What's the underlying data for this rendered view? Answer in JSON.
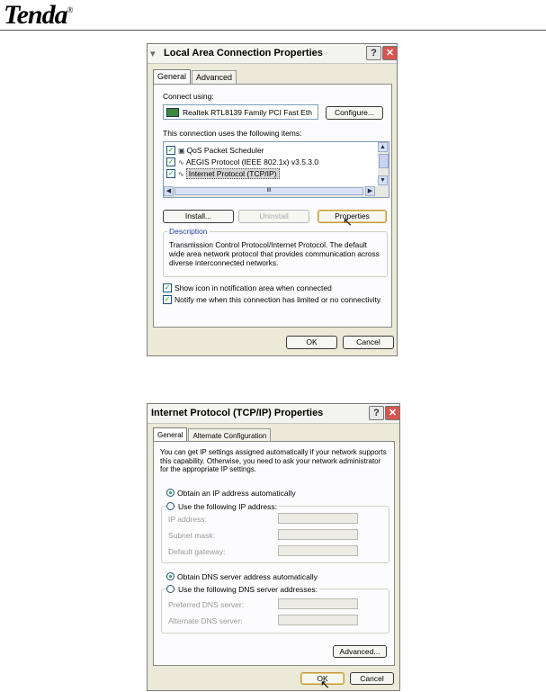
{
  "header": {
    "logo_text": "Tenda",
    "logo_mark": "®"
  },
  "dialog1": {
    "title": "Local Area Connection Properties",
    "tabs": [
      "General",
      "Advanced"
    ],
    "connect_using_label": "Connect using:",
    "adapter_name": "Realtek RTL8139 Family PCI Fast Eth",
    "configure_label": "Configure...",
    "items_label": "This connection uses the following items:",
    "items": [
      {
        "label": "QoS Packet Scheduler",
        "checked": true
      },
      {
        "label": "AEGIS Protocol (IEEE 802.1x) v3.5.3.0",
        "checked": true
      },
      {
        "label": "Internet Protocol (TCP/IP)",
        "checked": true,
        "selected": true
      }
    ],
    "scroll_mid": "III",
    "install_label": "Install...",
    "uninstall_label": "Uninstall",
    "properties_label": "Properties",
    "description_title": "Description",
    "description_text": "Transmission Control Protocol/Internet Protocol. The default wide area network protocol that provides communication across diverse interconnected networks.",
    "show_icon_label": "Show icon in notification area when connected",
    "notify_label": "Notify me when this connection has limited or no connectivity",
    "ok_label": "OK",
    "cancel_label": "Cancel"
  },
  "dialog2": {
    "title": "Internet Protocol (TCP/IP) Properties",
    "tabs": [
      "General",
      "Alternate Configuration"
    ],
    "intro_text": "You can get IP settings assigned automatically if your network supports this capability. Otherwise, you need to ask your network administrator for the appropriate IP settings.",
    "obtain_ip_label": "Obtain an IP address automatically",
    "use_ip_label": "Use the following IP address:",
    "ip_address_label": "IP address:",
    "subnet_label": "Subnet mask:",
    "gateway_label": "Default gateway:",
    "obtain_dns_label": "Obtain DNS server address automatically",
    "use_dns_label": "Use the following DNS server addresses:",
    "preferred_dns_label": "Preferred DNS server:",
    "alternate_dns_label": "Alternate DNS server:",
    "advanced_label": "Advanced...",
    "ok_label": "OK",
    "cancel_label": "Cancel"
  }
}
